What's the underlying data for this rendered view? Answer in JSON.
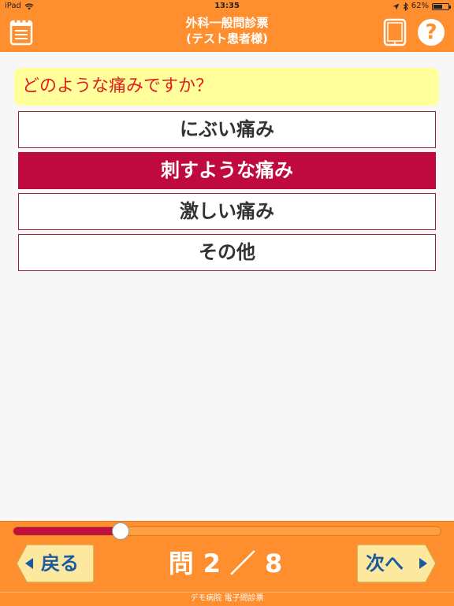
{
  "status_bar": {
    "device": "iPad",
    "time": "13:35",
    "battery": "62%",
    "battery_level": 0.62
  },
  "header": {
    "title_line1": "外科一般問診票",
    "title_line2": "(テスト患者様)",
    "help_label": "?"
  },
  "question": {
    "text": "どのような痛みですか？"
  },
  "options": [
    {
      "label": "にぶい痛み",
      "selected": false
    },
    {
      "label": "刺すような痛み",
      "selected": true
    },
    {
      "label": "激しい痛み",
      "selected": false
    },
    {
      "label": "その他",
      "selected": false
    }
  ],
  "progress": {
    "fraction": 0.25,
    "current": "2",
    "total": "8",
    "prefix": "問",
    "separator": "／"
  },
  "navigation": {
    "back_label": "戻る",
    "next_label": "次へ"
  },
  "footer": {
    "text": "デモ病院 電子問診票"
  },
  "colors": {
    "header_bg": "#ff8f2e",
    "question_bg": "#ffff9c",
    "question_text": "#e02020",
    "selected_option_bg": "#be0a3e",
    "nav_button_bg": "#fde8a0",
    "nav_text": "#1a5aa0"
  },
  "icons": {
    "menu": "notepad-icon",
    "tablet": "tablet-icon",
    "help": "help-icon",
    "back": "arrow-left-icon",
    "next": "arrow-right-icon"
  }
}
